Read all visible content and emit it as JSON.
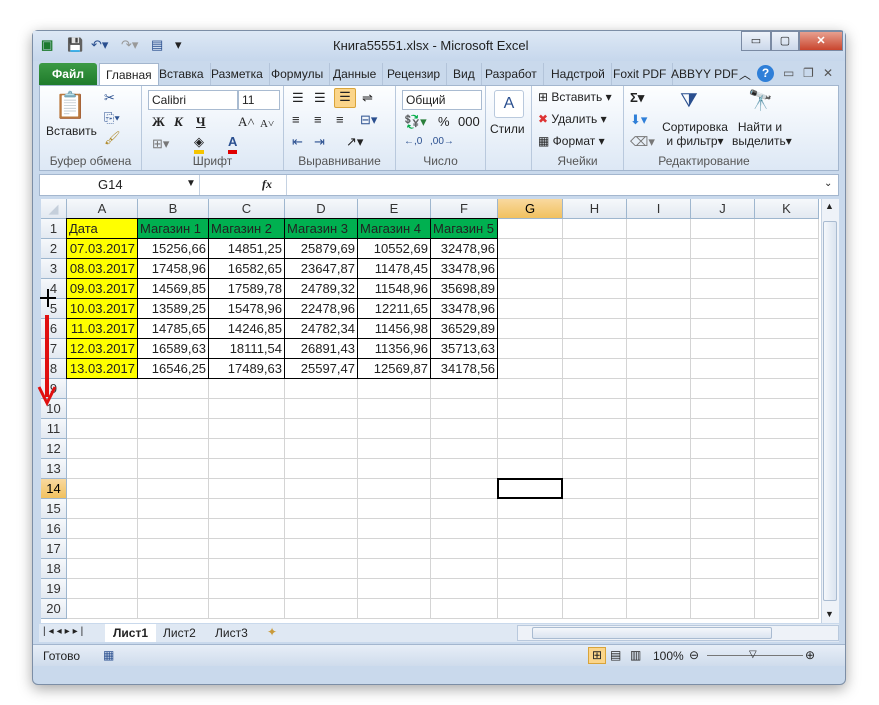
{
  "window": {
    "title": "Книга55551.xlsx  -  Microsoft Excel",
    "minimize": "▭",
    "restore": "▢",
    "close": "✕"
  },
  "tabs": [
    {
      "label": "Файл"
    },
    {
      "label": "Главная"
    },
    {
      "label": "Вставка"
    },
    {
      "label": "Разметка"
    },
    {
      "label": "Формулы"
    },
    {
      "label": "Данные"
    },
    {
      "label": "Рецензир"
    },
    {
      "label": "Вид"
    },
    {
      "label": "Разработ"
    },
    {
      "label": "Надстрой"
    },
    {
      "label": "Foxit PDF"
    },
    {
      "label": "ABBYY PDF"
    }
  ],
  "ribbon": {
    "clipboard": {
      "paste": "Вставить",
      "label": "Буфер обмена"
    },
    "font": {
      "name": "Calibri",
      "size": "11",
      "bold": "Ж",
      "italic": "К",
      "underline": "Ч",
      "label": "Шрифт"
    },
    "alignment": {
      "label": "Выравнивание"
    },
    "number": {
      "format": "Общий",
      "percent": "%",
      "thousands": "000",
      "label": "Число"
    },
    "styles": {
      "label": "Стили"
    },
    "cells": {
      "insert": "Вставить",
      "delete": "Удалить",
      "format": "Формат",
      "label": "Ячейки"
    },
    "editing": {
      "sort": "Сортировка",
      "sort2": "и фильтр",
      "find": "Найти и",
      "find2": "выделить",
      "label": "Редактирование"
    }
  },
  "formula_bar": {
    "name_box": "G14",
    "fx": "fx",
    "value": ""
  },
  "columns": [
    "A",
    "B",
    "C",
    "D",
    "E",
    "F",
    "G",
    "H",
    "I",
    "J",
    "K"
  ],
  "rows": [
    [
      "Дата",
      "Магазин 1",
      "Магазин 2",
      "Магазин 3",
      "Магазин 4",
      "Магазин 5"
    ],
    [
      "07.03.2017",
      "15256,66",
      "14851,25",
      "25879,69",
      "10552,69",
      "32478,96"
    ],
    [
      "08.03.2017",
      "17458,96",
      "16582,65",
      "23647,87",
      "11478,45",
      "33478,96"
    ],
    [
      "09.03.2017",
      "14569,85",
      "17589,78",
      "24789,32",
      "11548,96",
      "35698,89"
    ],
    [
      "10.03.2017",
      "13589,25",
      "15478,96",
      "22478,96",
      "12211,65",
      "33478,96"
    ],
    [
      "11.03.2017",
      "14785,65",
      "14246,85",
      "24782,34",
      "11456,98",
      "36529,89"
    ],
    [
      "12.03.2017",
      "16589,63",
      "18111,54",
      "26891,43",
      "11356,96",
      "35713,63"
    ],
    [
      "13.03.2017",
      "16546,25",
      "17489,63",
      "25597,47",
      "12569,87",
      "34178,56"
    ]
  ],
  "row_count": 20,
  "selected": {
    "col": "G",
    "row": 14
  },
  "colors": {
    "date_fill": "#ffff00",
    "header_fill": "#00b050",
    "arrow": "#e01010"
  },
  "sheets": [
    {
      "label": "Лист1",
      "active": true
    },
    {
      "label": "Лист2"
    },
    {
      "label": "Лист3"
    }
  ],
  "status": {
    "ready": "Готово",
    "zoom": "100%"
  }
}
